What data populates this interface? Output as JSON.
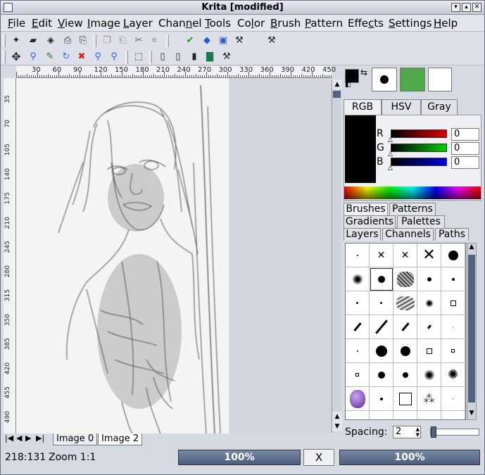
{
  "window": {
    "title": "Krita [modified]"
  },
  "menu": [
    {
      "label": "File",
      "u": "F",
      "rest": "ile"
    },
    {
      "label": "Edit",
      "u": "E",
      "rest": "dit"
    },
    {
      "label": "View",
      "u": "V",
      "rest": "iew"
    },
    {
      "label": "Image",
      "u": "I",
      "rest": "mage"
    },
    {
      "label": "Layer",
      "u": "L",
      "rest": "ayer"
    },
    {
      "label": "Channel",
      "pre": "Chan",
      "u": "n",
      "rest": "el"
    },
    {
      "label": "Tools",
      "u": "T",
      "rest": "ools"
    },
    {
      "label": "Color",
      "pre": "Co",
      "u": "l",
      "rest": "or"
    },
    {
      "label": "Brush",
      "u": "B",
      "rest": "rush"
    },
    {
      "label": "Pattern",
      "u": "P",
      "rest": "attern"
    },
    {
      "label": "Effects",
      "pre": "Effe",
      "u": "c",
      "rest": "ts"
    },
    {
      "label": "Settings",
      "u": "S",
      "rest": "ettings"
    },
    {
      "label": "Help",
      "u": "H",
      "rest": "elp"
    }
  ],
  "ruler": {
    "top": [
      "30",
      "60",
      "90",
      "120",
      "150",
      "180",
      "210",
      "240",
      "270",
      "300",
      "330",
      "360",
      "390",
      "420",
      "450"
    ],
    "left": [
      "35",
      "70",
      "105",
      "140",
      "175",
      "210",
      "245",
      "280",
      "315",
      "350",
      "385",
      "420",
      "455",
      "490"
    ]
  },
  "image_tabs": [
    "Image 0",
    "Image 2"
  ],
  "status": {
    "coords": "218:131",
    "zoom": "Zoom 1:1",
    "progress1": "100%",
    "cancel": "X",
    "progress2": "100%"
  },
  "color_tabs": [
    "RGB",
    "HSV",
    "Gray"
  ],
  "channels": [
    {
      "label": "R",
      "value": "0",
      "color": "#e00000"
    },
    {
      "label": "G",
      "value": "0",
      "color": "#00d000"
    },
    {
      "label": "B",
      "value": "0",
      "color": "#0000e0"
    }
  ],
  "panel_tabs": {
    "row1": [
      "Brushes",
      "Patterns"
    ],
    "row2": [
      "Gradients",
      "Palettes"
    ],
    "row3": [
      "Layers",
      "Channels",
      "Paths"
    ]
  },
  "spacing": {
    "label": "Spacing:",
    "value": "2"
  },
  "colors": {
    "foreground": "#000000",
    "background": "#ffffff",
    "pattern": "#4fa84a",
    "accent": "#53637f"
  }
}
